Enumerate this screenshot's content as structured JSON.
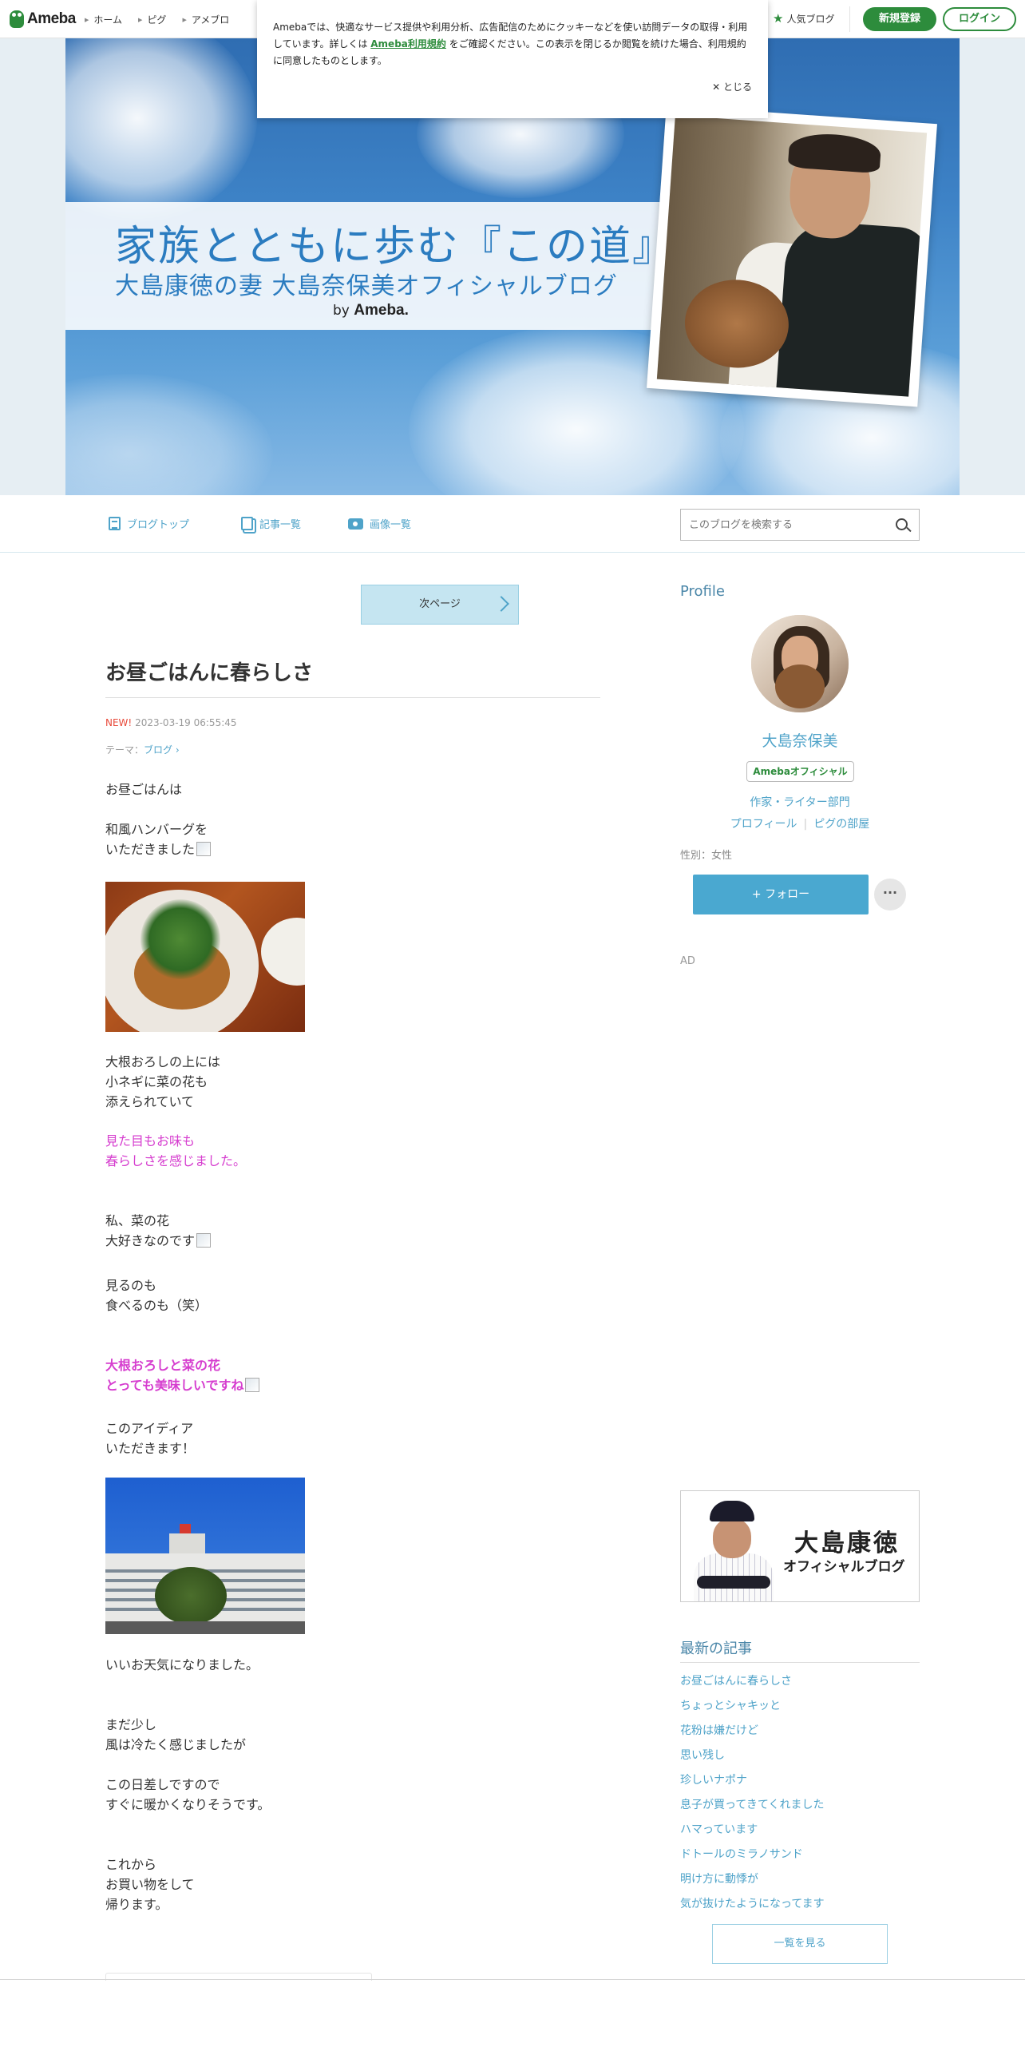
{
  "header": {
    "logo_text": "Ameba",
    "nav": [
      "ホーム",
      "ピグ",
      "アメブロ"
    ],
    "popular_label": "人気ブログ",
    "register_label": "新規登録",
    "login_label": "ログイン"
  },
  "cookie_banner": {
    "text_before": "Amebaでは、快適なサービス提供や利用分析、広告配信のためにクッキーなどを使い訪問データの取得・利用しています。詳しくは ",
    "link_text": "Ameba利用規約",
    "text_after": " をご確認ください。この表示を閉じるか閲覧を続けた場合、利用規約に同意したものとします。",
    "close_label": "✕ とじる"
  },
  "hero": {
    "title": "家族とともに歩む『この道』",
    "subtitle": "大島康徳の妻 大島奈保美オフィシャルブログ",
    "by_prefix": "by",
    "by_brand": "Ameba."
  },
  "blog_nav": {
    "items": [
      "ブログトップ",
      "記事一覧",
      "画像一覧"
    ],
    "search_placeholder": "このブログを検索する"
  },
  "article": {
    "next_page_label": "次ページ",
    "title": "お昼ごはんに春らしさ",
    "new_badge": "NEW!",
    "date": "2023-03-19 06:55:45",
    "theme_prefix": "テーマ：",
    "theme": "ブログ",
    "p1": [
      "お昼ごはんは"
    ],
    "p2": [
      "和風ハンバーグを",
      "いただきました"
    ],
    "p3": [
      "大根おろしの上には",
      "小ネギに菜の花も",
      "添えられていて"
    ],
    "p4": [
      "見た目もお味も",
      "春らしさを感じました。"
    ],
    "p5": [
      "私、菜の花",
      "大好きなのです"
    ],
    "p6": [
      "見るのも",
      "食べるのも（笑）"
    ],
    "p7": [
      "大根おろしと菜の花",
      "とっても美味しいですね"
    ],
    "p8": [
      "このアイディア",
      "いただきます！"
    ],
    "p9": [
      "いいお天気になりました。"
    ],
    "p10": [
      "まだ少し",
      "風は冷たく感じましたが"
    ],
    "p11": [
      "この日差しですので",
      "すぐに暖かくなりそうです。"
    ],
    "p12": [
      "これから",
      "お買い物をして",
      "帰ります。"
    ]
  },
  "sidebar": {
    "profile_heading": "Profile",
    "name": "大島奈保美",
    "badge": "Amebaオフィシャル",
    "category": "作家・ライター部門",
    "link_profile": "プロフィール",
    "link_pig": "ピグの部屋",
    "gender": "性別：女性",
    "follow_label": "+ フォロー",
    "more_label": "···",
    "ad_label": "AD",
    "banner_name": "大島康徳",
    "banner_sub": "オフィシャルブログ",
    "latest_heading": "最新の記事",
    "latest_items": [
      "お昼ごはんに春らしさ",
      "ちょっとシャキッと",
      "花粉は嫌だけど",
      "思い残し",
      "珍しいナポナ",
      "息子が買ってきてくれました",
      "ハマっています",
      "ドトールのミラノサンド",
      "明け方に動悸が",
      "気が抜けたようになってます"
    ],
    "see_all_label": "一覧を見る"
  },
  "colors": {
    "brand_green": "#2d8c3c",
    "link_blue": "#4fa3c9",
    "follow_blue": "#4aa8d0",
    "pink_text": "#d63ecf",
    "new_red": "#e84a3a"
  }
}
